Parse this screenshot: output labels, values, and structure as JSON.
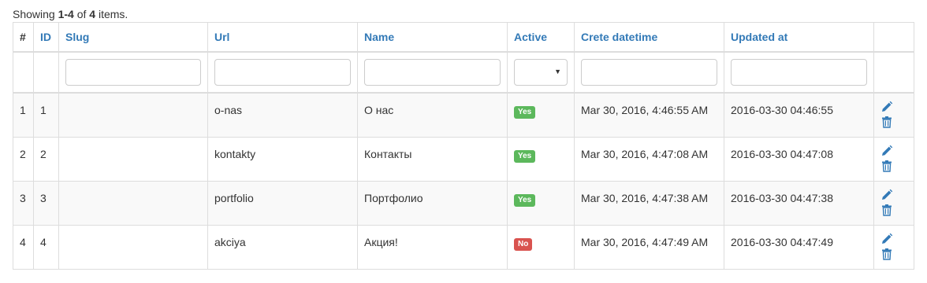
{
  "summary": {
    "prefix": "Showing ",
    "range": "1-4",
    "middle": " of ",
    "total": "4",
    "suffix": " items."
  },
  "columns": [
    "#",
    "ID",
    "Slug",
    "Url",
    "Name",
    "Active",
    "Crete datetime",
    "Updated at"
  ],
  "colors": {
    "link": "#337ab7",
    "yes": "#5cb85c",
    "no": "#d9534f"
  },
  "rows": [
    {
      "num": "1",
      "id": "1",
      "slug": "",
      "url": "o-nas",
      "name": "О нас",
      "active": "Yes",
      "created": "Mar 30, 2016, 4:46:55 AM",
      "updated": "2016-03-30 04:46:55"
    },
    {
      "num": "2",
      "id": "2",
      "slug": "",
      "url": "kontakty",
      "name": "Контакты",
      "active": "Yes",
      "created": "Mar 30, 2016, 4:47:08 AM",
      "updated": "2016-03-30 04:47:08"
    },
    {
      "num": "3",
      "id": "3",
      "slug": "",
      "url": "portfolio",
      "name": "Портфолио",
      "active": "Yes",
      "created": "Mar 30, 2016, 4:47:38 AM",
      "updated": "2016-03-30 04:47:38"
    },
    {
      "num": "4",
      "id": "4",
      "slug": "",
      "url": "akciya",
      "name": "Акция!",
      "active": "No",
      "created": "Mar 30, 2016, 4:47:49 AM",
      "updated": "2016-03-30 04:47:49"
    }
  ],
  "icons": {
    "update": "pencil-icon",
    "delete": "trash-icon"
  }
}
